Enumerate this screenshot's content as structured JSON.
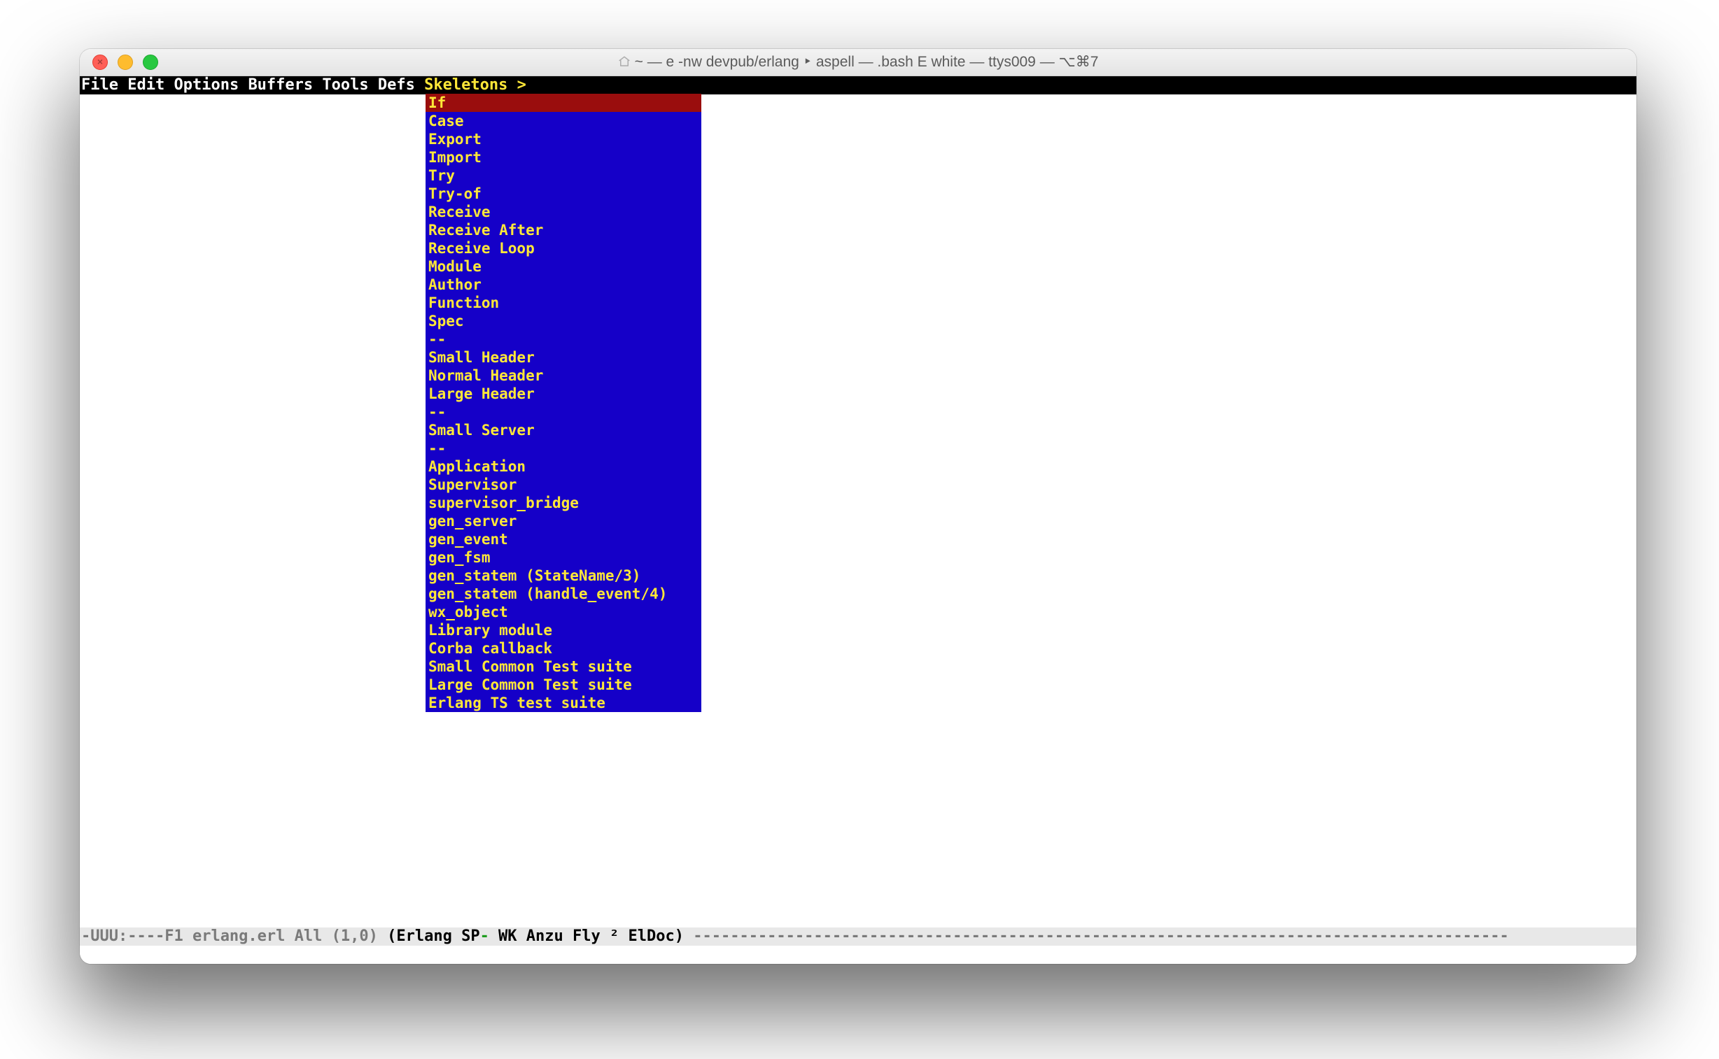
{
  "window": {
    "title": "~ — e -nw devpub/erlang ‣ aspell — .bash E white — ttys009 — ⌥⌘7"
  },
  "menubar": {
    "items": [
      "File",
      "Edit",
      "Options",
      "Buffers",
      "Tools",
      "Defs"
    ],
    "open_item": "Skeletons >"
  },
  "dropdown": {
    "highlight_index": 0,
    "items": [
      "If",
      "Case",
      "Export",
      "Import",
      "Try",
      "Try-of",
      "Receive",
      "Receive After",
      "Receive Loop",
      "Module",
      "Author",
      "Function",
      "Spec",
      "--",
      "Small Header",
      "Normal Header",
      "Large Header",
      "--",
      "Small Server",
      "--",
      "Application",
      "Supervisor",
      "supervisor_bridge",
      "gen_server",
      "gen_event",
      "gen_fsm",
      "gen_statem (StateName/3)",
      "gen_statem (handle_event/4)",
      "wx_object",
      "Library module",
      "Corba callback",
      "Small Common Test suite",
      "Large Common Test suite",
      "Erlang TS test suite"
    ]
  },
  "modeline": {
    "left": "-UUU:----F1  ",
    "buffer": "erlang.erl",
    "pos": "     All (1,0)      ",
    "modes_open": "(Erlang SP",
    "modes_dash": "-",
    "modes_rest": " WK Anzu Fly ² ElDoc) ",
    "fill": "----------------------------------------------------------------------------------------"
  }
}
